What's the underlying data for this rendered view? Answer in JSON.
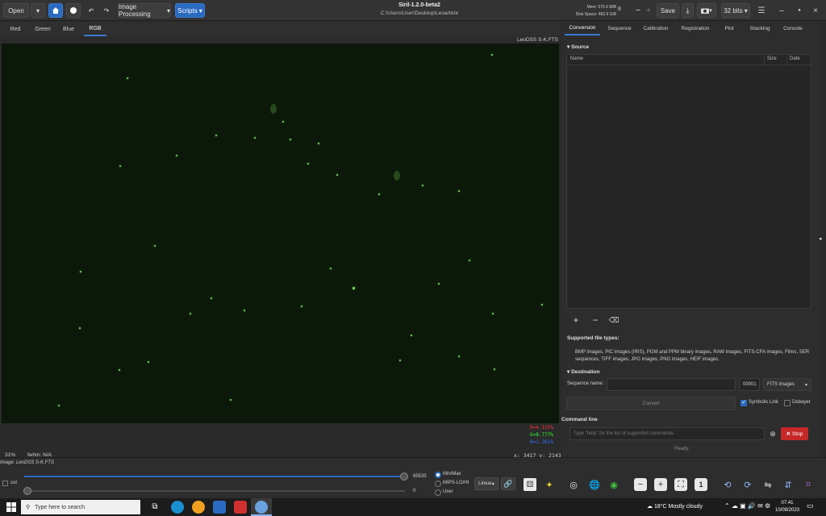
{
  "window": {
    "title": "Siril-1.2.0-beta2",
    "path": "C:\\Users\\User\\Desktop\\Leoarticle"
  },
  "toolbar": {
    "open_label": "Open",
    "image_processing_label": "Image Processing",
    "scripts_label": "Scripts",
    "mem_label": "Mem: 575.6 MiB",
    "disk_label": "Disk Space: 482.9 GiB",
    "counter": "8",
    "save_label": "Save",
    "bits_label": "32 bits"
  },
  "channel_tabs": [
    "Red",
    "Green",
    "Blue",
    "RGB"
  ],
  "image": {
    "filename": "LeoDSS S-K.FTS",
    "zoom": "31%",
    "fwhm": "fwhm: N/A",
    "coords": "x: 3417  y: 2143",
    "r_value": "R=4.135%",
    "g_value": "G=8.777%",
    "b_value": "B=1.261%"
  },
  "panel": {
    "tabs": [
      "Conversion",
      "Sequence",
      "Calibration",
      "Registration",
      "Plot",
      "Stacking",
      "Console"
    ],
    "source_label": "Source",
    "columns": [
      "Name",
      "Size",
      "Date"
    ],
    "supported_title": "Supported file types:",
    "supported_text": "BMP images, PIC images (IRIS), PGM and PPM binary images, RAW images, FITS-CFA images, Films, SER sequences, TIFF images, JPG images, PNG images, HEIF images.",
    "destination_label": "Destination",
    "sequence_name_label": "Sequence name:",
    "sequence_index": "00001",
    "format_option": "FITS images",
    "convert_label": "Convert",
    "symbolic_link_label": "Symbolic Link",
    "debayer_label": "Debayer",
    "command_line_label": "Command line",
    "command_placeholder": "Type \"help\" for the list of supported commands",
    "stop_label": "Stop",
    "status": "Ready."
  },
  "bottom": {
    "image_label": "Image: LeoDSS S-K.FTS",
    "max_value": "65535",
    "min_value": "0",
    "cut_label": "cut",
    "minmax_label": "Min/Max",
    "mipslo_label": "MIPS-LO/HI",
    "user_label": "User",
    "stretch_label": "Linear",
    "zoom_one": "1"
  },
  "taskbar": {
    "search_placeholder": "Type here to search",
    "weather": "18°C  Mostly cloudy",
    "time": "07:41",
    "date": "10/09/2023"
  },
  "colors": {
    "accent": "#2a6bc1",
    "stop_red": "#c62828",
    "r_text": "#ff3030",
    "g_text": "#30ff30",
    "b_text": "#3070ff"
  }
}
